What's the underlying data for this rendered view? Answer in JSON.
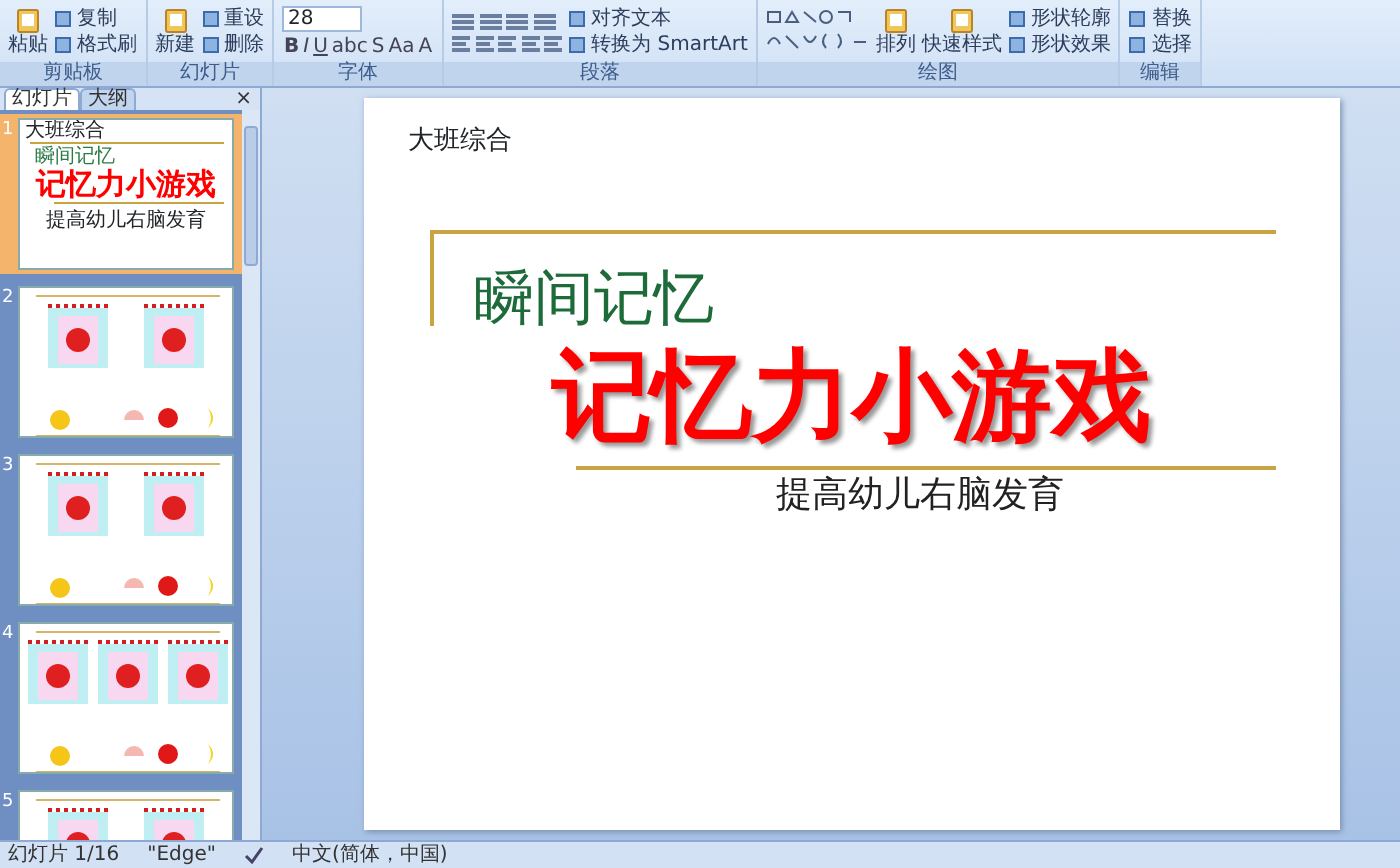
{
  "ribbon": {
    "groups": [
      {
        "label": "剪贴板",
        "items": [
          {
            "kind": "large",
            "label": "粘贴"
          },
          {
            "kind": "small",
            "label": "复制"
          },
          {
            "kind": "small",
            "label": "格式刷"
          }
        ]
      },
      {
        "label": "幻灯片",
        "items": [
          {
            "kind": "large",
            "label": "新建"
          },
          {
            "kind": "small",
            "label": "重设"
          },
          {
            "kind": "small",
            "label": "删除"
          }
        ]
      },
      {
        "label": "字体",
        "items": [
          {
            "kind": "field",
            "value": "28"
          },
          {
            "kind": "format",
            "labels": [
              "B",
              "I",
              "U",
              "abc",
              "S",
              "Aa",
              "A"
            ]
          }
        ]
      },
      {
        "label": "段落",
        "items": [
          {
            "kind": "para"
          },
          {
            "kind": "small",
            "label": "对齐文本"
          },
          {
            "kind": "small",
            "label": "转换为 SmartArt"
          }
        ]
      },
      {
        "label": "绘图",
        "items": [
          {
            "kind": "shapes"
          },
          {
            "kind": "large",
            "label": "排列"
          },
          {
            "kind": "large",
            "label": "快速样式"
          },
          {
            "kind": "small",
            "label": "形状轮廓"
          },
          {
            "kind": "small",
            "label": "形状效果"
          }
        ]
      },
      {
        "label": "编辑",
        "items": [
          {
            "kind": "small",
            "label": "替换"
          },
          {
            "kind": "small",
            "label": "选择"
          }
        ]
      }
    ]
  },
  "pane": {
    "tabs": [
      {
        "label": "幻灯片",
        "selected": true
      },
      {
        "label": "大纲",
        "selected": false
      }
    ],
    "close": "×",
    "slides": [
      {
        "number": "1",
        "selected": true,
        "kind": "title",
        "header": "大班综合",
        "title": "瞬间记忆",
        "main": "记忆力小游戏",
        "subtitle": "提高幼儿右脑发育"
      },
      {
        "number": "2",
        "selected": false,
        "kind": "two-cards"
      },
      {
        "number": "3",
        "selected": false,
        "kind": "two-cards"
      },
      {
        "number": "4",
        "selected": false,
        "kind": "three-cards"
      },
      {
        "number": "5",
        "selected": false,
        "kind": "two-cards"
      }
    ]
  },
  "slide": {
    "header": "大班综合",
    "title": "瞬间记忆",
    "main": "记忆力小游戏",
    "subtitle": "提高幼儿右脑发育"
  },
  "status_bar": {
    "slide": "幻灯片 1/16",
    "theme": "\"Edge\"",
    "language": "中文(简体，中国)"
  }
}
